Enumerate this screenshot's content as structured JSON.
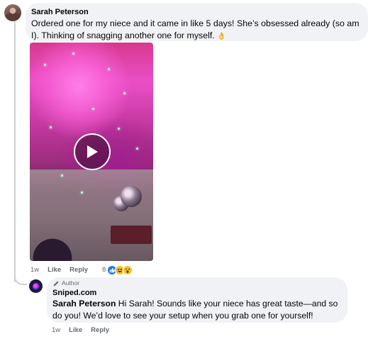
{
  "comment": {
    "author": "Sarah Peterson",
    "text": "Ordered one for my niece and it came in like 5 days! She’s obsessed already (so am I). Thinking of snagging another one for myself.",
    "emoji": "👌",
    "timestamp": "1w",
    "like_label": "Like",
    "reply_label": "Reply",
    "reaction_count": "8",
    "reaction_icons": [
      "like-icon",
      "haha-icon",
      "wow-icon"
    ]
  },
  "reply": {
    "badge": "Author",
    "author": "Sniped.com",
    "mention": "Sarah Peterson",
    "text": " Hi Sarah! Sounds like your niece has great taste—and so do you! We’d love to see your setup when you grab one for yourself!",
    "timestamp": "1w",
    "like_label": "Like",
    "reply_label": "Reply"
  },
  "colors": {
    "bubble": "#f0f2f5",
    "secondary_text": "#65676b",
    "like_blue": "#1877f2"
  }
}
